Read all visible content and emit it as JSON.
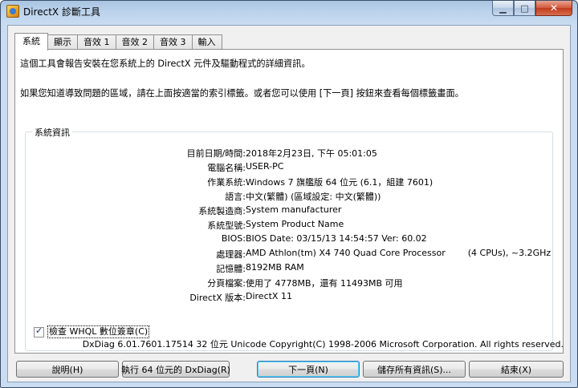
{
  "window": {
    "title": "DirectX 診斷工具",
    "minimize_glyph": "▁",
    "maximize_glyph": "□",
    "close_glyph": "✕"
  },
  "tabs": [
    {
      "label": "系統",
      "active": true
    },
    {
      "label": "顯示",
      "active": false
    },
    {
      "label": "音效 1",
      "active": false
    },
    {
      "label": "音效 2",
      "active": false
    },
    {
      "label": "音效 3",
      "active": false
    },
    {
      "label": "輸入",
      "active": false
    }
  ],
  "intro": {
    "line1": "這個工具會報告安裝在您系統上的 DirectX 元件及驅動程式的詳細資訊。",
    "line2": "如果您知道導致問題的區域，請在上面按適當的索引標籤。或者您可以使用 [下一頁] 按鈕來查看每個標籤畫面。"
  },
  "system_info": {
    "title": "系統資訊",
    "rows": [
      {
        "label": "目前日期/時間:",
        "value": "2018年2月23日, 下午 05:01:05"
      },
      {
        "label": "電腦名稱:",
        "value": "USER-PC"
      },
      {
        "label": "作業系統:",
        "value": "Windows 7 旗艦版 64 位元 (6.1，組建 7601)"
      },
      {
        "label": "語言:",
        "value": "中文(繁體) (區域設定: 中文(繁體))"
      },
      {
        "label": "系統製造商:",
        "value": "System manufacturer"
      },
      {
        "label": "系統型號:",
        "value": "System Product Name"
      },
      {
        "label": "BIOS:",
        "value": "BIOS Date: 03/15/13 14:54:57 Ver: 60.02"
      },
      {
        "label": "處理器:",
        "value": "AMD Athlon(tm) X4 740 Quad Core Processor        (4 CPUs), ~3.2GHz"
      },
      {
        "label": "記憶體:",
        "value": "8192MB RAM"
      },
      {
        "label": "分頁檔案:",
        "value": "使用了 4778MB，還有 11493MB 可用"
      },
      {
        "label": "DirectX 版本:",
        "value": "DirectX 11"
      }
    ],
    "whql_label": "檢查 WHQL 數位簽章(C)",
    "whql_checked": true
  },
  "footer_text": "DxDiag 6.01.7601.17514 32 位元 Unicode  Copyright(C) 1998-2006 Microsoft Corporation.  All rights reserved.",
  "buttons": {
    "help": "說明(H)",
    "run64": "執行 64 位元的 DxDiag(R)",
    "next": "下一頁(N)",
    "save": "儲存所有資訊(S)...",
    "exit": "結束(X)"
  }
}
